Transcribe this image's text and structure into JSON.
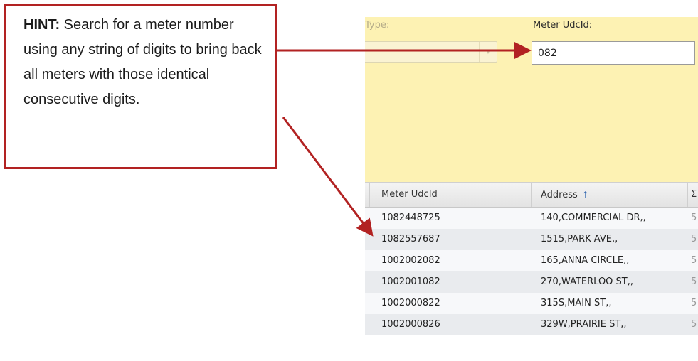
{
  "hint": {
    "title": "HINT:",
    "text": "Search for a meter number using any string of digits to bring back all meters with those identical consecutive digits."
  },
  "filters": {
    "type_label": "Type:",
    "meter_label": "Meter UdcId:",
    "meter_value": "082"
  },
  "grid": {
    "columns": [
      "Meter UdcId",
      "Address",
      "Σ"
    ],
    "sort_icon": "sort-ascending-icon",
    "rows": [
      {
        "meter": "1082448725",
        "address": "140,COMMERCIAL DR,,",
        "extra": "5"
      },
      {
        "meter": "1082557687",
        "address": "1515,PARK AVE,,",
        "extra": "5"
      },
      {
        "meter": "1002002082",
        "address": "165,ANNA CIRCLE,,",
        "extra": "5"
      },
      {
        "meter": "1002001082",
        "address": "270,WATERLOO ST,,",
        "extra": "5"
      },
      {
        "meter": "1002000822",
        "address": "315S,MAIN ST,,",
        "extra": "5"
      },
      {
        "meter": "1002000826",
        "address": "329W,PRAIRIE ST,,",
        "extra": "5"
      }
    ]
  },
  "colors": {
    "callout_red": "#b22222",
    "filter_bg": "#fdf2b3"
  }
}
